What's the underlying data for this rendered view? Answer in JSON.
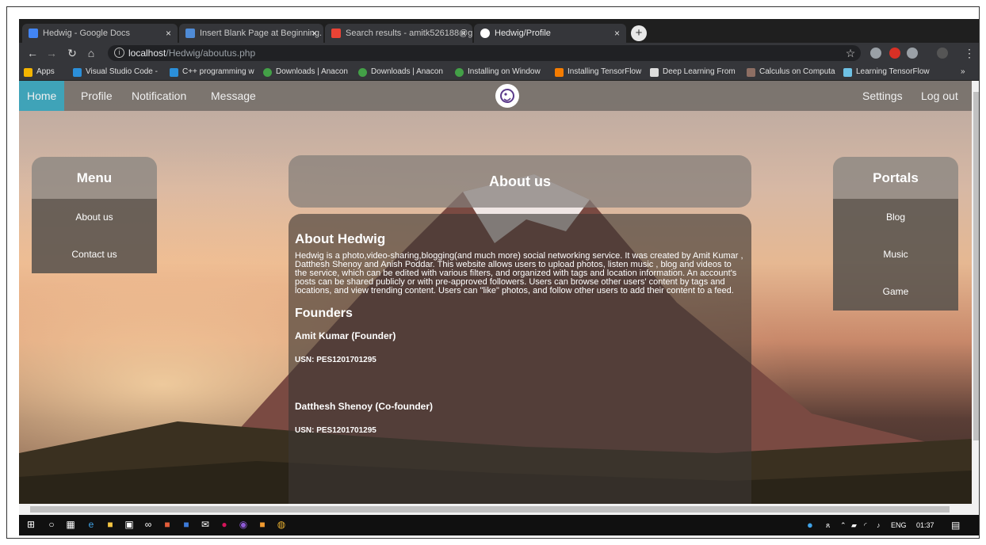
{
  "browser": {
    "tabs": [
      {
        "title": "Hedwig - Google Docs",
        "icon": "docs-icon",
        "color": "#4285f4"
      },
      {
        "title": "Insert Blank Page at Beginning. -",
        "icon": "search-doc-icon",
        "color": "#4f8bd6"
      },
      {
        "title": "Search results - amitk526188@g",
        "icon": "gmail-icon",
        "color": "#ea4335"
      },
      {
        "title": "Hedwig/Profile",
        "icon": "hedwig-icon",
        "color": "#ffffff"
      }
    ],
    "new_tab": "+",
    "close_glyph": "×",
    "address": {
      "info": "i",
      "host": "localhost",
      "path": "/Hedwig/aboutus.php"
    },
    "bookmarks": [
      {
        "label": "Apps",
        "color": "#f4b400"
      },
      {
        "label": "Visual Studio Code -",
        "color": "#2b8fd9"
      },
      {
        "label": "C++ programming w",
        "color": "#2b8fd9"
      },
      {
        "label": "Downloads | Anacon",
        "color": "#43a047"
      },
      {
        "label": "Downloads | Anacon",
        "color": "#43a047"
      },
      {
        "label": "Installing on Window",
        "color": "#43a047"
      },
      {
        "label": "Installing TensorFlow",
        "color": "#f57c00"
      },
      {
        "label": "Deep Learning From",
        "color": "#dddddd"
      },
      {
        "label": "Calculus on Computa",
        "color": "#8d6e63"
      },
      {
        "label": "Learning TensorFlow",
        "color": "#6ec1e4"
      }
    ],
    "more": "»"
  },
  "site": {
    "nav_left": [
      "Home",
      "Profile",
      "Notification",
      "Message"
    ],
    "nav_right": [
      "Settings",
      "Log out"
    ],
    "menu": {
      "title": "Menu",
      "items": [
        "About us",
        "Contact us"
      ]
    },
    "portals": {
      "title": "Portals",
      "items": [
        "Blog",
        "Music",
        "Game"
      ]
    },
    "about_title": "About us",
    "content": {
      "heading": "About Hedwig",
      "paragraph": "Hedwig is a photo,video-sharing,blogging(and much more) social networking service. It was created by Amit Kumar , Datthesh Shenoy and Anish Poddar. This website allows users to upload photos, listen music , blog and videos to the service, which can be edited with various filters, and organized with tags and location information. An account's posts can be shared publicly or with pre-approved followers. Users can browse other users' content by tags and locations, and view trending content. Users can \"like\" photos, and follow other users to add their content to a feed.",
      "founders_heading": "Founders",
      "founders": [
        {
          "name": "Amit Kumar (Founder)",
          "usn": "USN: PES1201701295"
        },
        {
          "name": "Datthesh Shenoy (Co-founder)",
          "usn": "USN: PES1201701295"
        }
      ]
    }
  },
  "taskbar": {
    "tray": {
      "lang": "ENG",
      "time": "01:37"
    }
  }
}
